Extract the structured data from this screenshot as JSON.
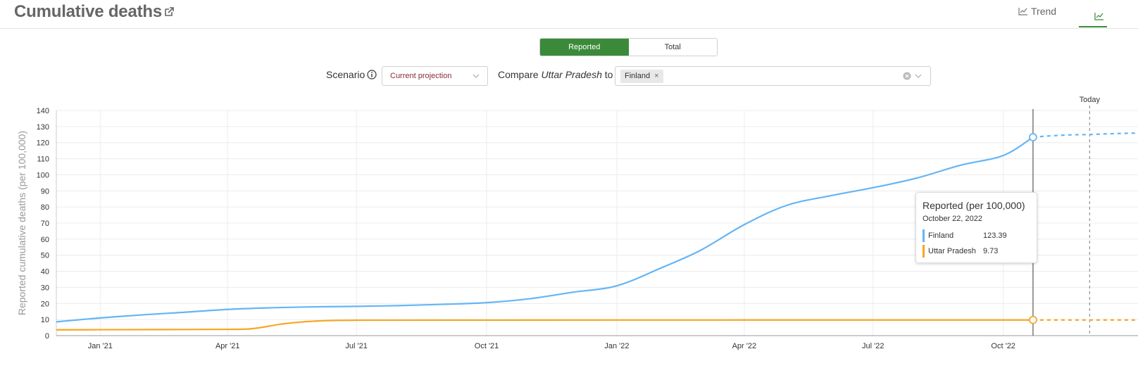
{
  "header": {
    "title": "Cumulative deaths",
    "tabs": [
      {
        "label": "Trend",
        "icon": "line-chart-icon"
      },
      {
        "label": "",
        "icon": "line-chart-icon",
        "active": true
      }
    ]
  },
  "toggle": {
    "reported": "Reported",
    "total": "Total",
    "active": "Reported"
  },
  "controls": {
    "scenario_label": "Scenario",
    "scenario_value": "Current projection",
    "compare_prefix": "Compare",
    "compare_location": "Uttar Pradesh",
    "compare_suffix": "to",
    "compare_chip": "Finland"
  },
  "colors": {
    "finland": "#64b5f6",
    "uttar_pradesh": "#f5a623",
    "accent": "#3a8a3a"
  },
  "chart_data": {
    "type": "line",
    "ylabel": "Reported cumulative deaths (per 100,000)",
    "ylim": [
      0,
      140
    ],
    "yticks": [
      0,
      10,
      20,
      30,
      40,
      50,
      60,
      70,
      80,
      90,
      100,
      110,
      120,
      130,
      140
    ],
    "xlim": [
      "2020-12-01",
      "2023-01-15"
    ],
    "xticks": [
      {
        "date": "2021-01-01",
        "label": "Jan '21"
      },
      {
        "date": "2021-04-01",
        "label": "Apr '21"
      },
      {
        "date": "2021-07-01",
        "label": "Jul '21"
      },
      {
        "date": "2021-10-01",
        "label": "Oct '21"
      },
      {
        "date": "2022-01-01",
        "label": "Jan '22"
      },
      {
        "date": "2022-04-01",
        "label": "Apr '22"
      },
      {
        "date": "2022-07-01",
        "label": "Jul '22"
      },
      {
        "date": "2022-10-01",
        "label": "Oct '22"
      }
    ],
    "today_label": "Today",
    "today_date": "2022-12-01",
    "cursor_date": "2022-10-22",
    "series": [
      {
        "name": "Finland",
        "reported": [
          [
            "2020-12-01",
            8.6
          ],
          [
            "2021-01-01",
            11
          ],
          [
            "2021-02-01",
            13
          ],
          [
            "2021-03-01",
            14.5
          ],
          [
            "2021-04-01",
            16.3
          ],
          [
            "2021-05-01",
            17.3
          ],
          [
            "2021-06-01",
            17.9
          ],
          [
            "2021-07-01",
            18.2
          ],
          [
            "2021-08-01",
            18.7
          ],
          [
            "2021-09-01",
            19.5
          ],
          [
            "2021-10-01",
            20.5
          ],
          [
            "2021-11-01",
            23
          ],
          [
            "2021-12-01",
            27
          ],
          [
            "2022-01-01",
            31
          ],
          [
            "2022-02-01",
            42
          ],
          [
            "2022-03-01",
            53
          ],
          [
            "2022-04-01",
            69
          ],
          [
            "2022-05-01",
            81
          ],
          [
            "2022-06-01",
            87
          ],
          [
            "2022-07-01",
            92
          ],
          [
            "2022-08-01",
            98
          ],
          [
            "2022-09-01",
            106
          ],
          [
            "2022-10-01",
            112
          ],
          [
            "2022-10-22",
            123.39
          ]
        ],
        "projected": [
          [
            "2022-10-22",
            123.39
          ],
          [
            "2022-12-01",
            125
          ],
          [
            "2023-01-15",
            126
          ]
        ]
      },
      {
        "name": "Uttar Pradesh",
        "reported": [
          [
            "2020-12-01",
            3.6
          ],
          [
            "2021-01-01",
            3.7
          ],
          [
            "2021-04-01",
            3.9
          ],
          [
            "2021-04-20",
            4.5
          ],
          [
            "2021-05-10",
            7.3
          ],
          [
            "2021-06-01",
            9.0
          ],
          [
            "2021-07-01",
            9.6
          ],
          [
            "2021-10-01",
            9.65
          ],
          [
            "2022-01-01",
            9.7
          ],
          [
            "2022-04-01",
            9.72
          ],
          [
            "2022-07-01",
            9.73
          ],
          [
            "2022-10-22",
            9.73
          ]
        ],
        "projected": [
          [
            "2022-10-22",
            9.73
          ],
          [
            "2023-01-15",
            9.74
          ]
        ]
      }
    ]
  },
  "tooltip": {
    "title": "Reported (per 100,000)",
    "date": "October 22, 2022",
    "rows": [
      {
        "name": "Finland",
        "value": "123.39"
      },
      {
        "name": "Uttar Pradesh",
        "value": "9.73"
      }
    ]
  }
}
